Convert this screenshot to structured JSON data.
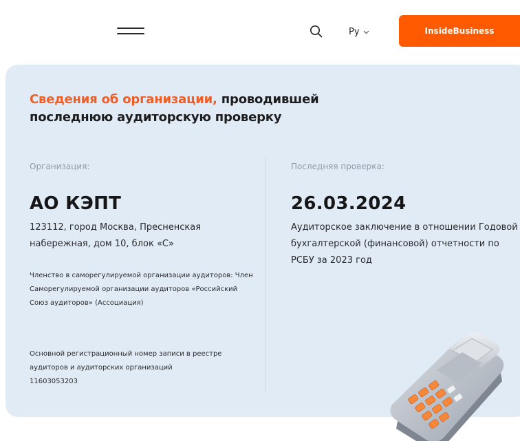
{
  "header": {
    "lang_label": "Ру",
    "cta_label": "InsideBusiness"
  },
  "card": {
    "title_accent": "Сведения об организации,",
    "title_rest_line1": " проводившей",
    "title_line2": "последнюю аудиторскую проверку",
    "org_label": "Организация:",
    "org_name": "АО КЭПТ",
    "org_address": "123112, город Москва, Пресненская набережная, дом 10, блок «С»",
    "membership": "Членство в саморегулируемой организации аудиторов: Член Саморегулируемой организации аудиторов «Российский Союз аудиторов» (Ассоциация)",
    "regnum_text": "Основной регистрационный номер записи в реестре аудиторов и аудиторских организаций",
    "regnum_value": "11603053203",
    "check_label": "Последняя проверка:",
    "check_date": "26.03.2024",
    "check_desc": "Аудиторское заключение в отношении Годовой бухгалтерской (финансовой) отчетности по РСБУ за 2023 год"
  },
  "colors": {
    "accent": "#ff5a00",
    "card_bg": "#e1ebf6",
    "title_accent": "#ec5f26"
  },
  "icons": [
    "menu-icon",
    "search-icon",
    "chevron-down-icon",
    "payment-terminal-illustration"
  ]
}
